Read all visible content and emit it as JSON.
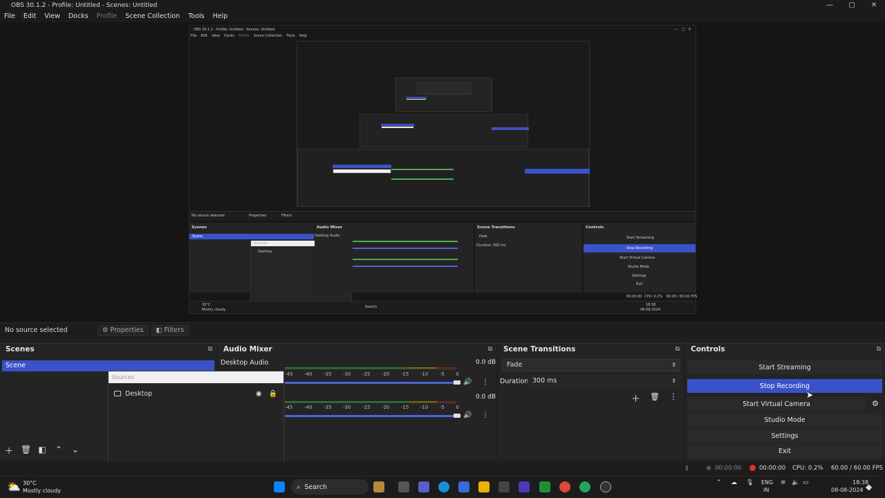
{
  "window": {
    "title": "OBS 30.1.2 - Profile: Untitled - Scenes: Untitled",
    "min_icon": "minimize-icon",
    "max_icon": "maximize-icon",
    "close_icon": "close-icon"
  },
  "menu": {
    "items": [
      "File",
      "Edit",
      "View",
      "Docks",
      "Profile",
      "Scene Collection",
      "Tools",
      "Help"
    ]
  },
  "preview": {
    "nested": {
      "title": "OBS 30.1.2 - Profile: Untitled - Scenes: Untitled",
      "menu": [
        "File",
        "Edit",
        "View",
        "Docks",
        "Profile",
        "Scene Collection",
        "Tools",
        "Help"
      ],
      "no_source": "No source selected",
      "properties": "Properties",
      "filters": "Filters",
      "scenes": "Scenes",
      "scene_item": "Scene",
      "audio_mixer": "Audio Mixer",
      "desktop_audio": "Desktop Audio",
      "sources": "Sources",
      "desktop": "Desktop",
      "scene_transitions": "Scene Transitions",
      "fade": "Fade",
      "duration": "Duration",
      "duration_value": "300 ms",
      "controls": "Controls",
      "start_streaming": "Start Streaming",
      "stop_recording": "Stop Recording",
      "start_virtual_camera": "Start Virtual Camera",
      "studio_mode": "Studio Mode",
      "settings": "Settings",
      "exit": "Exit",
      "weather_temp": "30°C",
      "weather_desc": "Mostly cloudy",
      "search": "Search",
      "time_rec": "00:00:00",
      "cpu": "CPU: 0.2%",
      "fps": "60.00 / 60.00 FPS",
      "clock_time": "18:38",
      "clock_date": "08-08-2024"
    }
  },
  "source_bar": {
    "no_source": "No source selected",
    "properties": "Properties",
    "filters": "Filters"
  },
  "scenes": {
    "title": "Scenes",
    "items": [
      "Scene"
    ]
  },
  "sources": {
    "title": "Sources",
    "items": [
      "Desktop"
    ]
  },
  "audio": {
    "title": "Audio Mixer",
    "channels": [
      {
        "name": "Desktop Audio",
        "db": "0.0 dB",
        "volume": 1.0
      },
      {
        "name": "",
        "db": "0.0 dB",
        "volume": 1.0
      }
    ],
    "ticks": [
      "-45",
      "-40",
      "-35",
      "-30",
      "-25",
      "-20",
      "-15",
      "-10",
      "-5",
      "0"
    ]
  },
  "transitions": {
    "title": "Scene Transitions",
    "selected": "Fade",
    "duration_label": "Duration",
    "duration_value": "300 ms"
  },
  "controls": {
    "title": "Controls",
    "start_streaming": "Start Streaming",
    "stop_recording": "Stop Recording",
    "start_virtual_camera": "Start Virtual Camera",
    "studio_mode": "Studio Mode",
    "settings": "Settings",
    "exit": "Exit"
  },
  "status": {
    "stream_time": "00:00:00",
    "rec_time": "00:00:00",
    "cpu": "CPU: 0.2%",
    "fps": "60.00 / 60.00 FPS"
  },
  "taskbar": {
    "weather_temp": "30°C",
    "weather_desc": "Mostly cloudy",
    "search": "Search",
    "lang_top": "ENG",
    "lang_bottom": "IN",
    "time": "18:38",
    "date": "08-08-2024"
  },
  "colors": {
    "accent": "#3a52c8",
    "rec_red": "#e03030",
    "meter_green": "#4caf50",
    "meter_yellow": "#c8b400",
    "meter_red": "#c83030"
  }
}
